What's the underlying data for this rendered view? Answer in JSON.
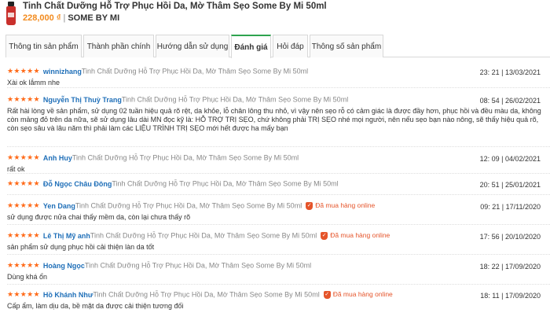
{
  "header": {
    "title": "Tinh Chất Dưỡng Hỗ Trợ Phục Hồi Da, Mờ Thâm Sẹo Some By Mi 50ml",
    "price": "228,000 ₫",
    "separator": "|",
    "brand": "SOME BY MI"
  },
  "tabs": [
    {
      "label": "Thông tin sản phẩm",
      "active": false
    },
    {
      "label": "Thành phần chính",
      "active": false
    },
    {
      "label": "Hướng dẫn sử dụng",
      "active": false
    },
    {
      "label": "Đánh giá",
      "active": true
    },
    {
      "label": "Hỏi đáp",
      "active": false
    },
    {
      "label": "Thông số sản phẩm",
      "active": false
    }
  ],
  "reviews": [
    {
      "stars": "★★★★★",
      "author": "winnizhang",
      "product": "Tinh Chất Dưỡng Hỗ Trợ Phục Hồi Da, Mờ Thâm Sẹo Some By Mi 50ml",
      "verified": "",
      "time": "23: 21 | 13/03/2021",
      "text": "Xài ok lắmm nhe"
    },
    {
      "stars": "★★★★★",
      "author": "Nguyễn Thị Thuỳ Trang",
      "product": "Tinh Chất Dưỡng Hỗ Trợ Phục Hồi Da, Mờ Thâm Sẹo Some By Mi 50ml",
      "verified": "",
      "time": "08: 54 | 26/02/2021",
      "text": "Rất hài lòng về sản phẩm, sử dụng 02 tuần hiệu quả rõ rệt, da khỏe, lỗ chân lông thu nhỏ, vì vậy nên sẹo rỗ có cảm giác là được đầy hơn, phục hồi và đều màu da, không còn mảng đỏ trên da nữa, sẽ sử dụng lâu dài MN đọc kỹ là: HỖ TRỢ TRỊ SẸO, chứ không phải TRỊ SẸO nhé mọi người, nên nếu sẹo bạn nào nông, sẽ thấy hiệu quả rõ, còn sẹo sâu và lâu năm thì phải làm các LIỆU TRÌNH TRỊ SẸO mới hết được ha mấy bạn"
    },
    {
      "stars": "★★★★★",
      "author": "Anh Huy",
      "product": "Tinh Chất Dưỡng Hỗ Trợ Phục Hồi Da, Mờ Thâm Sẹo Some By Mi 50ml",
      "verified": "",
      "time": "12: 09 | 04/02/2021",
      "text": "rất ok"
    },
    {
      "stars": "★★★★★",
      "author": "Đỗ Ngọc Châu Đông",
      "product": "Tinh Chất Dưỡng Hỗ Trợ Phục Hồi Da, Mờ Thâm Sẹo Some By Mi 50ml",
      "verified": "",
      "time": "20: 51 | 25/01/2021",
      "text": ""
    },
    {
      "stars": "★★★★★",
      "author": "Yen Dang",
      "product": "Tinh Chất Dưỡng Hỗ Trợ Phục Hồi Da, Mờ Thâm Sẹo Some By Mi 50ml",
      "verified": "Đã mua hàng online",
      "time": "09: 21 | 17/11/2020",
      "text": "sử dụng được nửa chai thấy mềm da, còn lại chưa thấy rõ"
    },
    {
      "stars": "★★★★★",
      "author": "Lê Thị Mỹ anh",
      "product": "Tinh Chất Dưỡng Hỗ Trợ Phục Hồi Da, Mờ Thâm Sẹo Some By Mi 50ml",
      "verified": "Đã mua hàng online",
      "time": "17: 56 | 20/10/2020",
      "text": "sản phẩm sử dụng phục hồi cải thiện làn da tốt"
    },
    {
      "stars": "★★★★★",
      "author": "Hoàng Ngọc",
      "product": "Tinh Chất Dưỡng Hỗ Trợ Phục Hồi Da, Mờ Thâm Sẹo Some By Mi 50ml",
      "verified": "",
      "time": "18: 22 | 17/09/2020",
      "text": "Dùng khá ổn"
    },
    {
      "stars": "★★★★★",
      "author": "Hồ Khánh Như",
      "product": "Tinh Chất Dưỡng Hỗ Trợ Phục Hồi Da, Mờ Thâm Sẹo Some By Mi 50ml",
      "verified": "Đã mua hàng online",
      "time": "18: 11 | 17/09/2020",
      "text": "Cấp ẩm, làm dịu da, bề mặt da được cải thiện tương đối"
    }
  ]
}
